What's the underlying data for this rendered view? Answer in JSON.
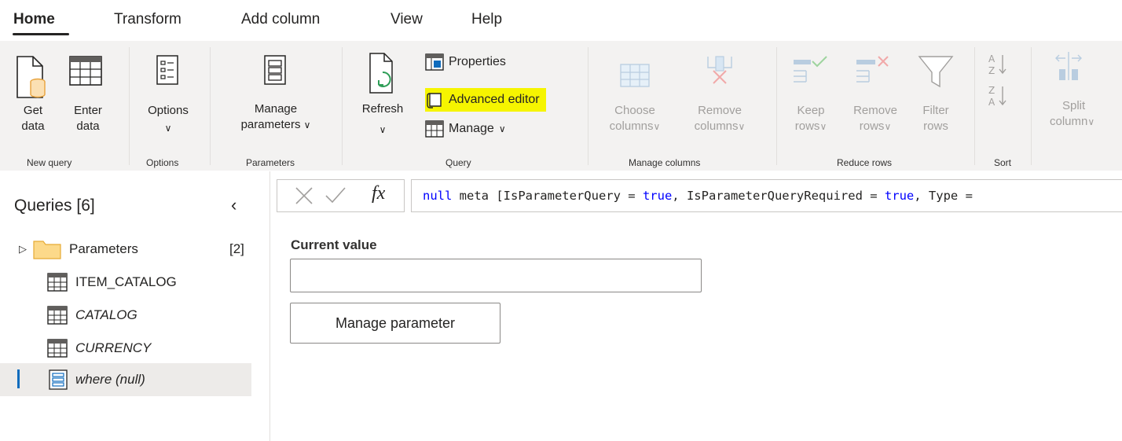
{
  "tabs": [
    "Home",
    "Transform",
    "Add column",
    "View",
    "Help"
  ],
  "ribbon": {
    "groups": {
      "new_query": "New query",
      "options": "Options",
      "parameters": "Parameters",
      "query": "Query",
      "manage_columns": "Manage columns",
      "reduce_rows": "Reduce rows",
      "sort": "Sort"
    },
    "get_data": [
      "Get",
      "data"
    ],
    "enter_data": [
      "Enter",
      "data"
    ],
    "options": "Options",
    "manage_parameters": [
      "Manage",
      "parameters"
    ],
    "refresh": "Refresh",
    "properties": "Properties",
    "advanced_editor": "Advanced editor",
    "manage": "Manage",
    "choose_columns": [
      "Choose",
      "columns"
    ],
    "remove_columns": [
      "Remove",
      "columns"
    ],
    "keep_rows": [
      "Keep",
      "rows"
    ],
    "remove_rows": [
      "Remove",
      "rows"
    ],
    "filter_rows": [
      "Filter",
      "rows"
    ],
    "split_column": [
      "Split",
      "column"
    ],
    "highlight_color": "#f6f500"
  },
  "queries": {
    "title": "Queries [6]",
    "items": [
      {
        "label": "Parameters",
        "count": "[2]",
        "icon": "folder-icon"
      },
      {
        "label": "ITEM_CATALOG",
        "icon": "table-icon"
      },
      {
        "label": "CATALOG",
        "icon": "table-icon"
      },
      {
        "label": "CURRENCY",
        "icon": "table-icon"
      },
      {
        "label": "where (null)",
        "icon": "parameter-icon"
      }
    ]
  },
  "formula": {
    "fx": "fx",
    "parts": [
      "null",
      " meta [IsParameterQuery = ",
      "true",
      ", IsParameterQueryRequired = ",
      "true",
      ", Type = "
    ]
  },
  "main": {
    "current_value_label": "Current value",
    "current_value": "",
    "manage_parameter_button": "Manage parameter"
  }
}
